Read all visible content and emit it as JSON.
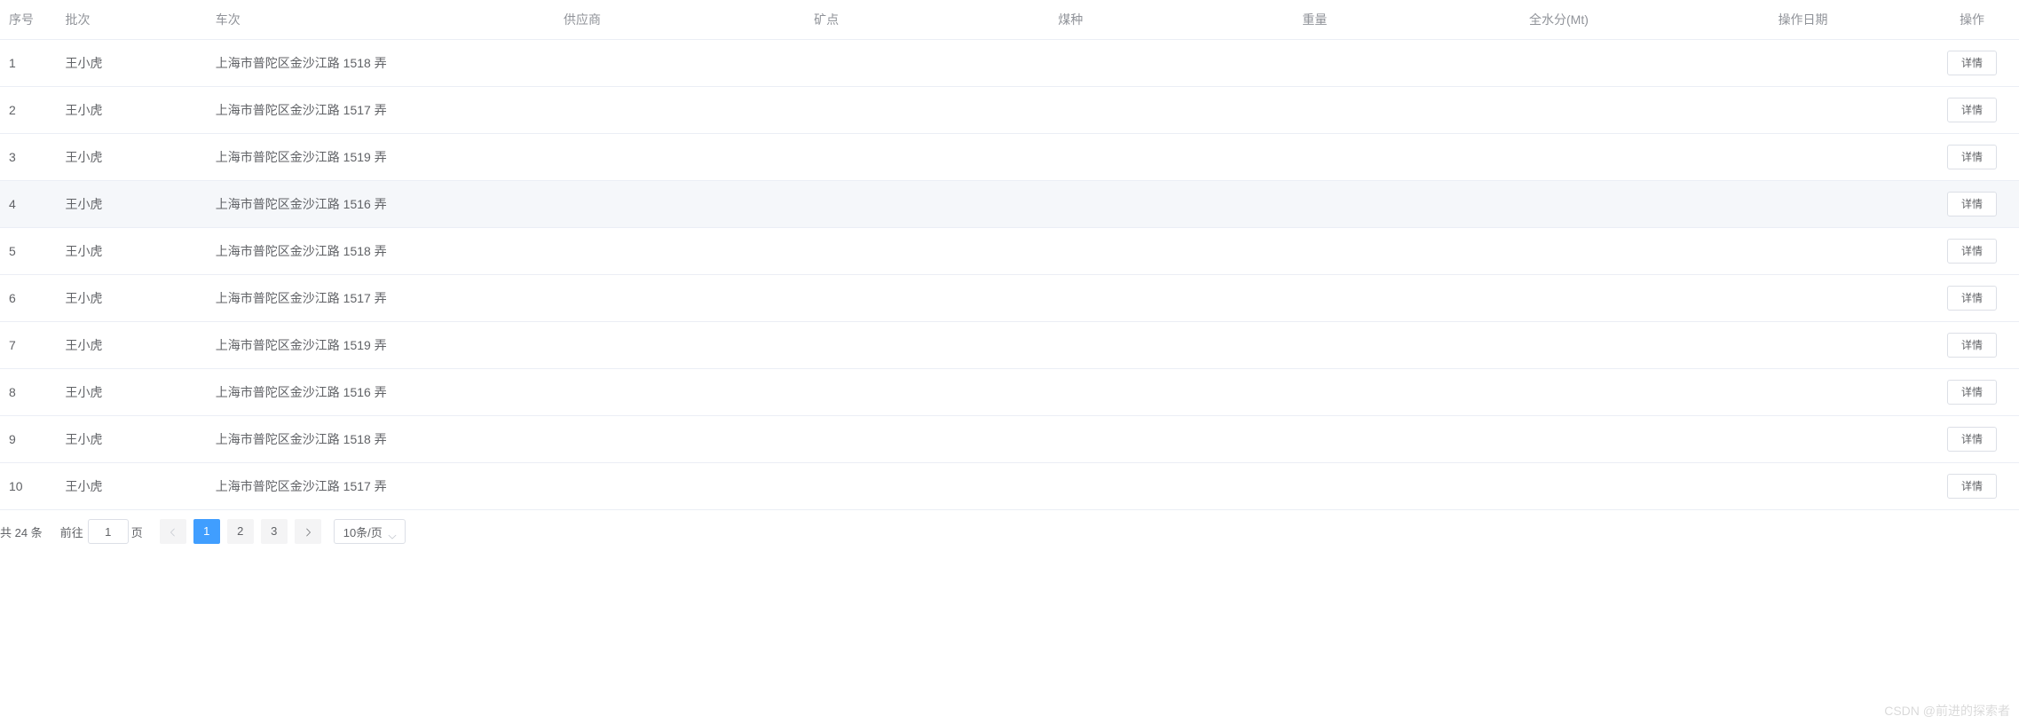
{
  "table": {
    "columns": [
      {
        "key": "index",
        "label": "序号"
      },
      {
        "key": "batch",
        "label": "批次"
      },
      {
        "key": "trip",
        "label": "车次"
      },
      {
        "key": "supplier",
        "label": "供应商"
      },
      {
        "key": "mine",
        "label": "矿点"
      },
      {
        "key": "coal",
        "label": "煤种"
      },
      {
        "key": "weight",
        "label": "重量"
      },
      {
        "key": "water",
        "label": "全水分(Mt)"
      },
      {
        "key": "date",
        "label": "操作日期"
      },
      {
        "key": "action",
        "label": "操作"
      }
    ],
    "rows": [
      {
        "index": "1",
        "batch": "王小虎",
        "trip": "上海市普陀区金沙江路 1518 弄",
        "supplier": "",
        "mine": "",
        "coal": "",
        "weight": "",
        "water": "",
        "date": ""
      },
      {
        "index": "2",
        "batch": "王小虎",
        "trip": "上海市普陀区金沙江路 1517 弄",
        "supplier": "",
        "mine": "",
        "coal": "",
        "weight": "",
        "water": "",
        "date": ""
      },
      {
        "index": "3",
        "batch": "王小虎",
        "trip": "上海市普陀区金沙江路 1519 弄",
        "supplier": "",
        "mine": "",
        "coal": "",
        "weight": "",
        "water": "",
        "date": ""
      },
      {
        "index": "4",
        "batch": "王小虎",
        "trip": "上海市普陀区金沙江路 1516 弄",
        "supplier": "",
        "mine": "",
        "coal": "",
        "weight": "",
        "water": "",
        "date": "",
        "hovered": true
      },
      {
        "index": "5",
        "batch": "王小虎",
        "trip": "上海市普陀区金沙江路 1518 弄",
        "supplier": "",
        "mine": "",
        "coal": "",
        "weight": "",
        "water": "",
        "date": ""
      },
      {
        "index": "6",
        "batch": "王小虎",
        "trip": "上海市普陀区金沙江路 1517 弄",
        "supplier": "",
        "mine": "",
        "coal": "",
        "weight": "",
        "water": "",
        "date": ""
      },
      {
        "index": "7",
        "batch": "王小虎",
        "trip": "上海市普陀区金沙江路 1519 弄",
        "supplier": "",
        "mine": "",
        "coal": "",
        "weight": "",
        "water": "",
        "date": ""
      },
      {
        "index": "8",
        "batch": "王小虎",
        "trip": "上海市普陀区金沙江路 1516 弄",
        "supplier": "",
        "mine": "",
        "coal": "",
        "weight": "",
        "water": "",
        "date": ""
      },
      {
        "index": "9",
        "batch": "王小虎",
        "trip": "上海市普陀区金沙江路 1518 弄",
        "supplier": "",
        "mine": "",
        "coal": "",
        "weight": "",
        "water": "",
        "date": ""
      },
      {
        "index": "10",
        "batch": "王小虎",
        "trip": "上海市普陀区金沙江路 1517 弄",
        "supplier": "",
        "mine": "",
        "coal": "",
        "weight": "",
        "water": "",
        "date": ""
      }
    ],
    "action_label": "详情"
  },
  "pagination": {
    "total_text": "共 24 条",
    "goto_label": "前往",
    "goto_value": "1",
    "goto_suffix": "页",
    "pages": [
      "1",
      "2",
      "3"
    ],
    "active_page": "1",
    "page_size_label": "10条/页"
  },
  "watermark": "CSDN @前进的探索者"
}
